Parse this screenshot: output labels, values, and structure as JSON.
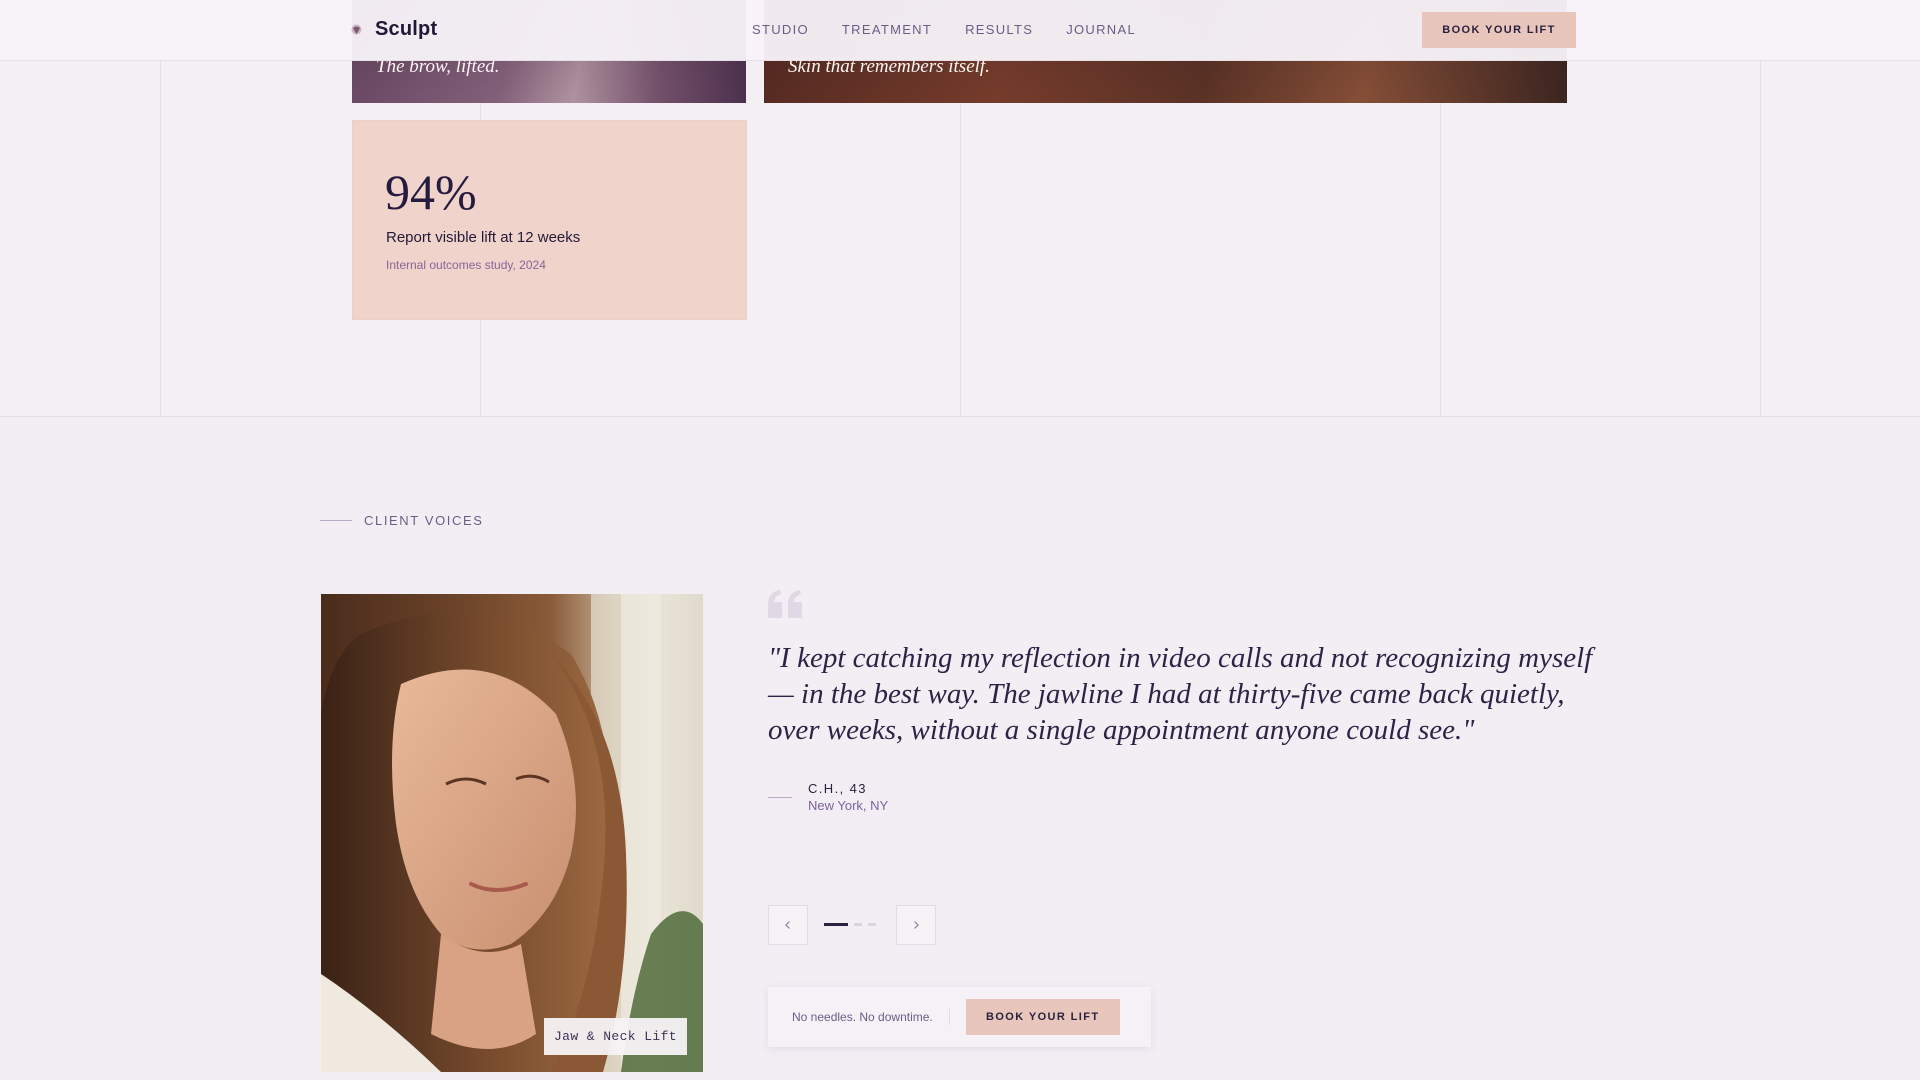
{
  "brand": {
    "name": "Sculpt",
    "mark_icon": "sculpt-logo-icon"
  },
  "nav": {
    "links": [
      "STUDIO",
      "TREATMENT",
      "RESULTS",
      "JOURNAL"
    ],
    "cta_label": "BOOK YOUR LIFT"
  },
  "gallery": {
    "cards": [
      {
        "caption": "The brow, lifted."
      },
      {
        "caption": "Skin that remembers itself."
      }
    ]
  },
  "stat": {
    "value": "94%",
    "label": "Report visible lift at 12 weeks",
    "source": "Internal outcomes study, 2024"
  },
  "testimonials": {
    "eyebrow": "CLIENT VOICES",
    "portrait_tag": "Jaw & Neck Lift",
    "quote": "\"I kept catching my reflection in video calls and not recognizing myself — in the best way. The jawline I had at thirty-five came back quietly, over weeks, without a single appointment anyone could see.\"",
    "author": "C.H., 43",
    "location": "New York, NY",
    "carousel": {
      "total": 3,
      "active": 1,
      "prev_icon": "chevron-left-icon",
      "next_icon": "chevron-right-icon"
    }
  },
  "cta_bar": {
    "note": "No needles. No downtime.",
    "button_label": "BOOK YOUR LIFT"
  },
  "colors": {
    "background": "#f3eef4",
    "accent": "#e8c6bc",
    "ink": "#2a2140",
    "muted": "#6a5e86"
  }
}
